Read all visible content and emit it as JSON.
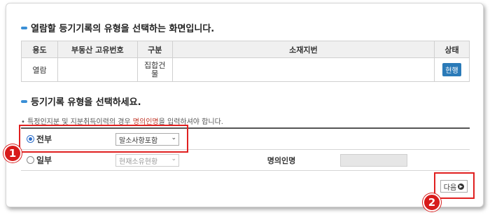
{
  "section1": {
    "title": "열람할 등기기록의 유형을 선택하는 화면입니다."
  },
  "table": {
    "headers": [
      "용도",
      "부동산 고유번호",
      "구분",
      "소재지번",
      "상태"
    ],
    "row": {
      "purpose": "열람",
      "unique_no": "",
      "category": "집합건물",
      "address": "",
      "status": "현행"
    }
  },
  "section2": {
    "title": "등기기록 유형을 선택하세요.",
    "note_prefix": "• 특정인지분 및 지분취득이력의 경우 ",
    "note_highlight": "명의인명",
    "note_suffix": "을 입력하셔야 합니다."
  },
  "form": {
    "option_full": {
      "label": "전부",
      "selected": true,
      "select_value": "말소사항포함"
    },
    "option_partial": {
      "label": "일부",
      "selected": false,
      "select_value": "현재소유현황"
    },
    "name_label": "명의인명",
    "name_value": ""
  },
  "next_button": {
    "label": "다음"
  },
  "badges": {
    "badge1": "1",
    "badge2": "2"
  },
  "colors": {
    "annotation_red": "#e02020",
    "status_blue": "#2a7ab8"
  }
}
